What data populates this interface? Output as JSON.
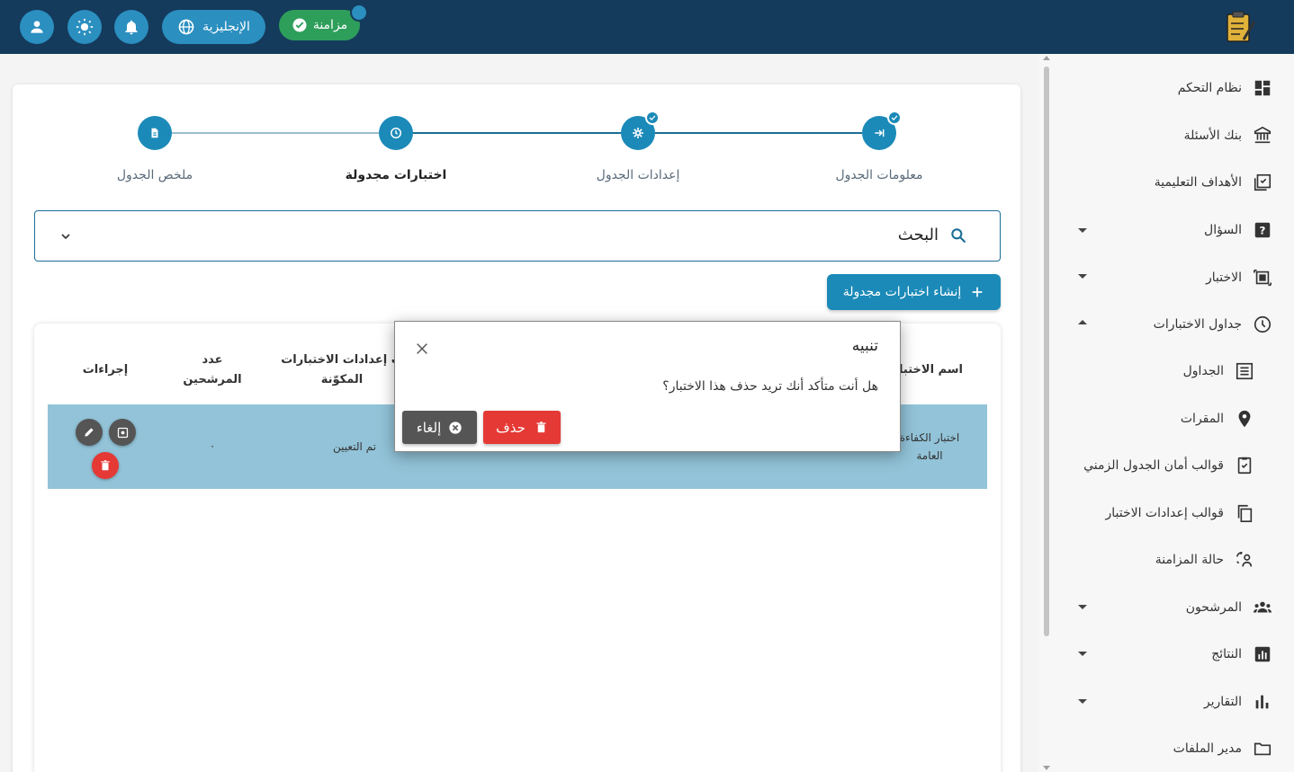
{
  "topbar": {
    "language_label": "الإنجليزية",
    "sync_label": "مزامنة",
    "icons": [
      "user-icon",
      "theme-sun-icon",
      "bell-icon",
      "globe-icon",
      "check-circle-icon",
      "exam-logo"
    ]
  },
  "sidebar": {
    "items": [
      {
        "label": "نظام التحكم",
        "icon": "dashboard-icon"
      },
      {
        "label": "بنك الأسئلة",
        "icon": "bank-icon"
      },
      {
        "label": "الأهداف التعليمية",
        "icon": "objectives-icon"
      },
      {
        "label": "السؤال",
        "icon": "question-icon"
      },
      {
        "label": "الاختبار",
        "icon": "exam-icon"
      },
      {
        "label": "جداول الاختبارات",
        "icon": "clock-icon"
      },
      {
        "label": "الجداول",
        "icon": "list-icon"
      },
      {
        "label": "المقرات",
        "icon": "location-icon"
      },
      {
        "label": "قوالب أمان الجدول الزمني",
        "icon": "security-template-icon"
      },
      {
        "label": "قوالب إعدادات الاختبار",
        "icon": "copy-icon"
      },
      {
        "label": "حالة المزامنة",
        "icon": "sync-status-icon"
      },
      {
        "label": "المرشحون",
        "icon": "people-icon"
      },
      {
        "label": "النتائج",
        "icon": "results-icon"
      },
      {
        "label": "التقارير",
        "icon": "reports-icon"
      },
      {
        "label": "مدير الملفات",
        "icon": "folder-icon"
      }
    ]
  },
  "stepper": {
    "steps": [
      {
        "label": "معلومات الجدول",
        "icon": "login-arrow-icon",
        "completed": true
      },
      {
        "label": "إعدادات الجدول",
        "icon": "gear-icon",
        "completed": true
      },
      {
        "label": "اختبارات مجدولة",
        "icon": "clock-icon",
        "active": true
      },
      {
        "label": "ملخص الجدول",
        "icon": "document-icon"
      }
    ]
  },
  "search": {
    "label": "البحث"
  },
  "create_button": {
    "label": "إنشاء اختبارات مجدولة"
  },
  "table": {
    "headers": {
      "exam_name": "اسم الاختبار",
      "settings": "إعدادات الاختبارات المكوّنة",
      "settings_partial": "ب إعدادات الاختبارات",
      "settings_line2": "المكوّنة",
      "candidates_line1": "عدد",
      "candidates_line2": "المرشحين",
      "actions": "إجراءات"
    },
    "rows": [
      {
        "exam_name_line1": "اختبار الكفاءة",
        "exam_name_line2": "العامة",
        "settings": "تم التعيين",
        "candidates": "·"
      }
    ]
  },
  "dialog": {
    "title": "تنبيه",
    "message": "هل أنت متأكد أنك تريد حذف هذا الاختبار؟",
    "delete_label": "حذف",
    "cancel_label": "إلغاء"
  },
  "colors": {
    "topbar": "#143b5c",
    "accent": "#1b8ab8",
    "sync_green": "#2e9e5b",
    "delete_red": "#e53935",
    "cancel_gray": "#555555",
    "selected_row": "#92c3d8"
  }
}
